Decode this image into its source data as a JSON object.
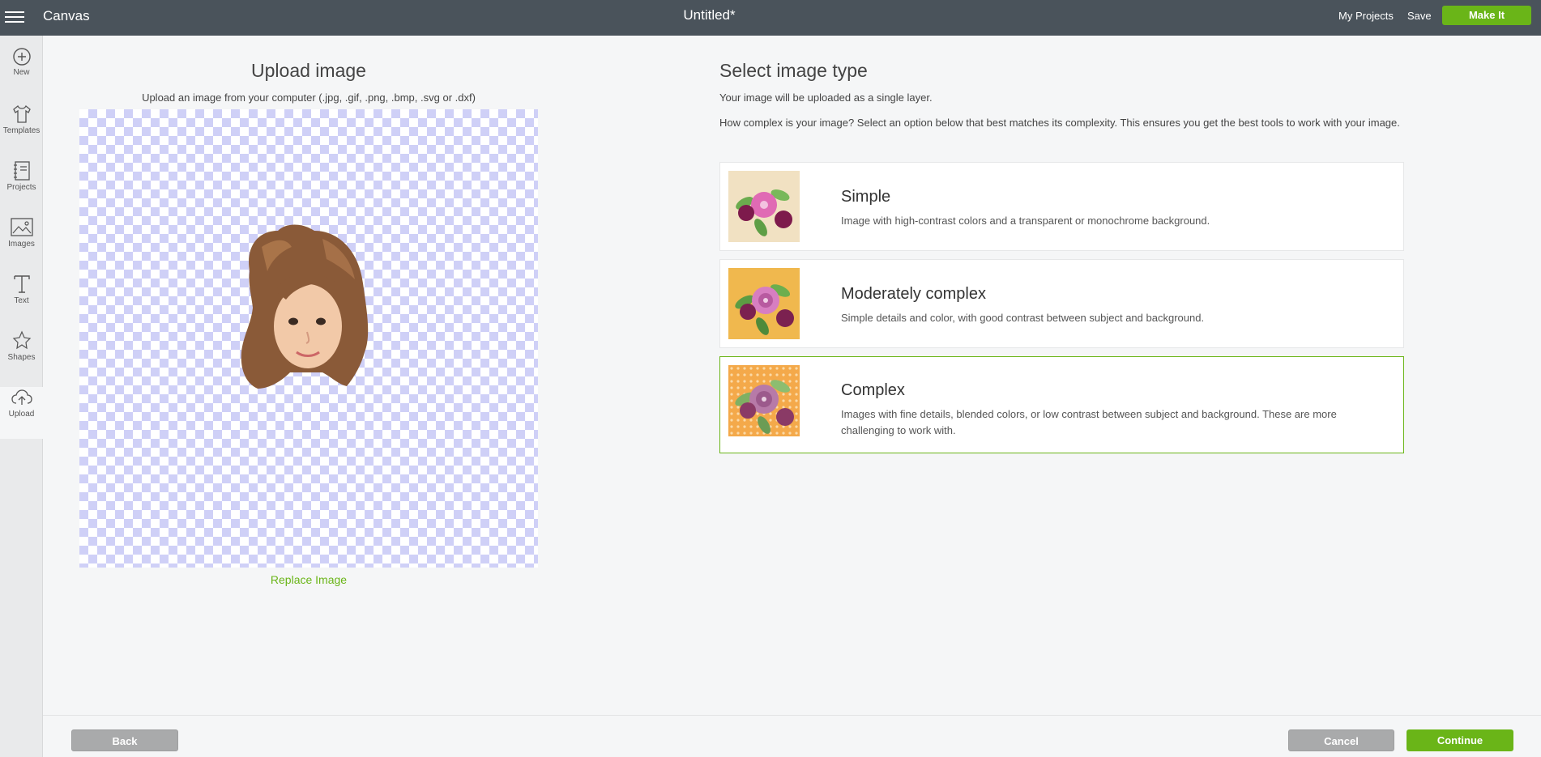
{
  "topbar": {
    "app_title": "Canvas",
    "doc_title": "Untitled*",
    "my_projects": "My Projects",
    "save": "Save",
    "make_it": "Make It"
  },
  "sidebar": {
    "items": [
      {
        "label": "New",
        "icon": "plus-circle-icon"
      },
      {
        "label": "Templates",
        "icon": "shirt-icon"
      },
      {
        "label": "Projects",
        "icon": "notebook-icon"
      },
      {
        "label": "Images",
        "icon": "image-icon"
      },
      {
        "label": "Text",
        "icon": "text-icon"
      },
      {
        "label": "Shapes",
        "icon": "shapes-icon"
      },
      {
        "label": "Upload",
        "icon": "cloud-upload-icon"
      }
    ]
  },
  "upload": {
    "title": "Upload image",
    "subtitle": "Upload an image from your computer (.jpg, .gif, .png, .bmp, .svg or .dxf)",
    "replace": "Replace Image"
  },
  "image_type": {
    "title": "Select image type",
    "layer_note": "Your image will be uploaded as a single layer.",
    "complexity_note": "How complex is your image? Select an option below that best matches its complexity. This ensures you get the best tools to work with your image.",
    "options": [
      {
        "name": "Simple",
        "description": "Image with high-contrast colors and a transparent or monochrome background.",
        "selected": false
      },
      {
        "name": "Moderately complex",
        "description": "Simple details and color, with good contrast between subject and background.",
        "selected": false
      },
      {
        "name": "Complex",
        "description": "Images with fine details, blended colors, or low contrast between subject and background. These are more challenging to work with.",
        "selected": true
      }
    ]
  },
  "footer": {
    "back": "Back",
    "cancel": "Cancel",
    "continue": "Continue"
  },
  "colors": {
    "accent": "#6ab518",
    "topbar": "#4a535b",
    "checker": "#cfd0f7"
  }
}
